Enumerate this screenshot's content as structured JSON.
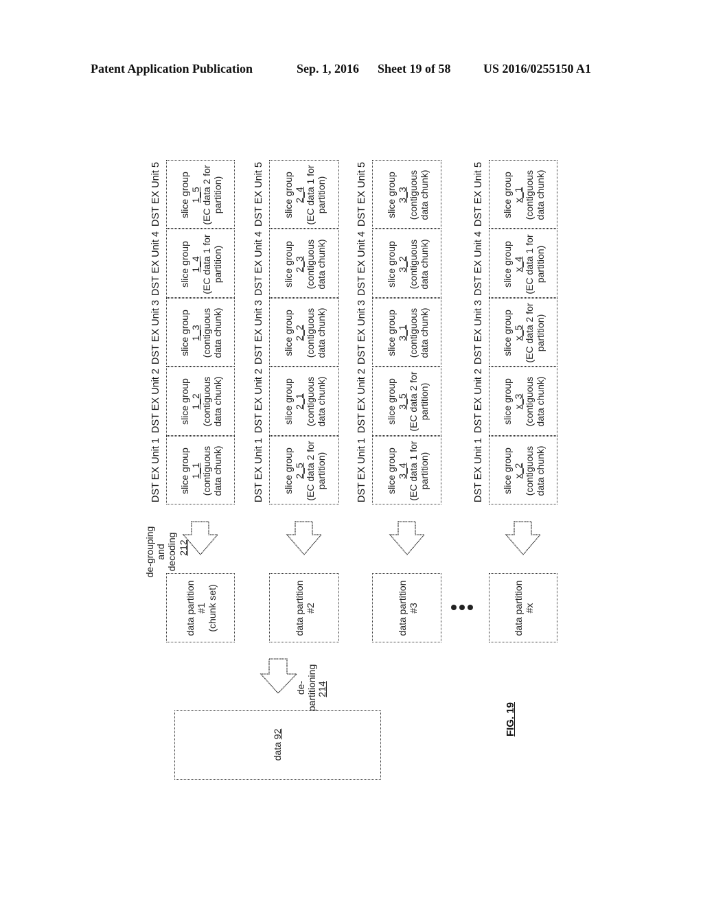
{
  "header": {
    "publication": "Patent Application Publication",
    "date": "Sep. 1, 2016",
    "sheet": "Sheet 19 of 58",
    "number": "US 2016/0255150 A1"
  },
  "unit_labels": [
    "DST EX Unit 1",
    "DST EX Unit 2",
    "DST EX Unit 3",
    "DST EX Unit 4",
    "DST EX Unit 5"
  ],
  "rows": [
    {
      "cells": [
        {
          "line1": "slice group",
          "id": "1_1",
          "line3": "(contiguous",
          "line4": "data chunk)"
        },
        {
          "line1": "slice group",
          "id": "1_2",
          "line3": "(contiguous",
          "line4": "data chunk)"
        },
        {
          "line1": "slice group",
          "id": "1_3",
          "line3": "(contiguous",
          "line4": "data chunk)"
        },
        {
          "line1": "slice group",
          "id": "1_4",
          "line3": "(EC data 1 for",
          "line4": "partition)"
        },
        {
          "line1": "slice group",
          "id": "1_5",
          "line3": "(EC data 2 for",
          "line4": "partition)"
        }
      ],
      "partition": {
        "line1": "data partition",
        "line2": "#1",
        "line3": "(chunk set)"
      }
    },
    {
      "cells": [
        {
          "line1": "slice group",
          "id": "2_5",
          "line3": "(EC data 2 for",
          "line4": "partition)"
        },
        {
          "line1": "slice group",
          "id": "2_1",
          "line3": "(contiguous",
          "line4": "data chunk)"
        },
        {
          "line1": "slice group",
          "id": "2_2",
          "line3": "(contiguous",
          "line4": "data chunk)"
        },
        {
          "line1": "slice group",
          "id": "2_3",
          "line3": "(contiguous",
          "line4": "data chunk)"
        },
        {
          "line1": "slice group",
          "id": "2_4",
          "line3": "(EC data 1 for",
          "line4": "partition)"
        }
      ],
      "partition": {
        "line1": "data partition",
        "line2": "#2",
        "line3": ""
      }
    },
    {
      "cells": [
        {
          "line1": "slice group",
          "id": "3_4",
          "line3": "(EC data 1 for",
          "line4": "partition)"
        },
        {
          "line1": "slice group",
          "id": "3_5",
          "line3": "(EC data 2 for",
          "line4": "partition)"
        },
        {
          "line1": "slice group",
          "id": "3_1",
          "line3": "(contiguous",
          "line4": "data chunk)"
        },
        {
          "line1": "slice group",
          "id": "3_2",
          "line3": "(contiguous",
          "line4": "data chunk)"
        },
        {
          "line1": "slice group",
          "id": "3_3",
          "line3": "(contiguous",
          "line4": "data chunk)"
        }
      ],
      "partition": {
        "line1": "data partition",
        "line2": "#3",
        "line3": ""
      }
    },
    {
      "cells": [
        {
          "line1": "slice group",
          "id": "x_2",
          "line3": "(contiguous",
          "line4": "data chunk)"
        },
        {
          "line1": "slice group",
          "id": "x_3",
          "line3": "(contiguous",
          "line4": "data chunk)"
        },
        {
          "line1": "slice group",
          "id": "x_5",
          "line3": "(EC data 2 for",
          "line4": "partition)"
        },
        {
          "line1": "slice group",
          "id": "x_4",
          "line3": "(EC data 1 for",
          "line4": "partition)"
        },
        {
          "line1": "slice group",
          "id": "x_1",
          "line3": "(contiguous",
          "line4": "data chunk)"
        }
      ],
      "partition": {
        "line1": "data partition",
        "line2": "#x",
        "line3": ""
      }
    }
  ],
  "degrouping_label": {
    "line1": "de-grouping",
    "line2": "and",
    "line3": "decoding",
    "ref": "212"
  },
  "departitioning_label": {
    "line1": "de-",
    "line2": "partitioning",
    "ref": "214"
  },
  "data_box": {
    "text": "data",
    "ref": "92"
  },
  "figure_label": "FIG. 19"
}
